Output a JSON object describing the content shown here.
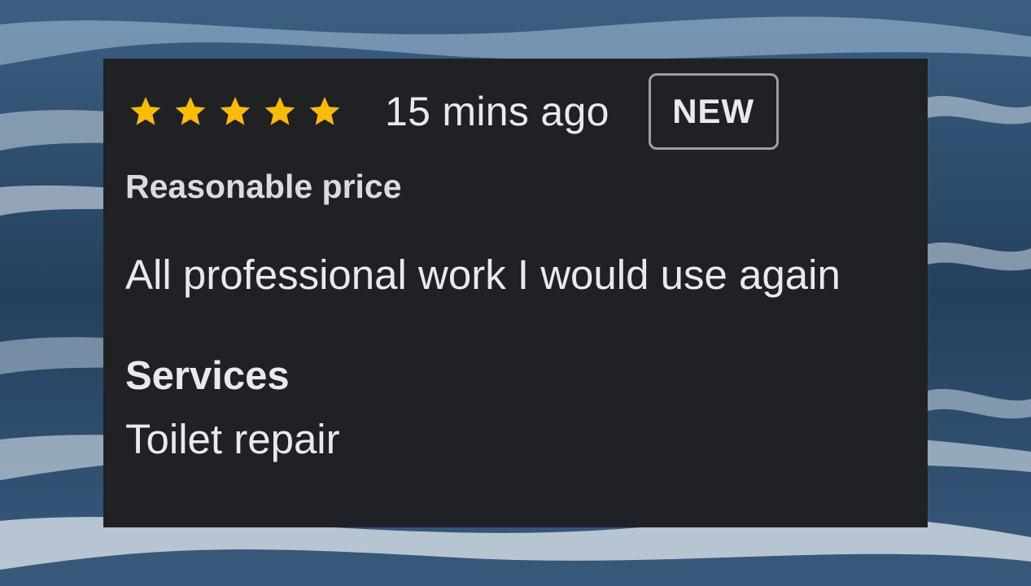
{
  "review": {
    "rating": 5,
    "rating_max": 5,
    "star_color": "#fbbc04",
    "time": "15 mins ago",
    "badge": "NEW",
    "attribute": "Reasonable price",
    "text": "All professional work I would use again",
    "services_label": "Services",
    "services_value": "Toilet repair"
  },
  "colors": {
    "card_background": "#202124",
    "text": "#e8eaed"
  }
}
